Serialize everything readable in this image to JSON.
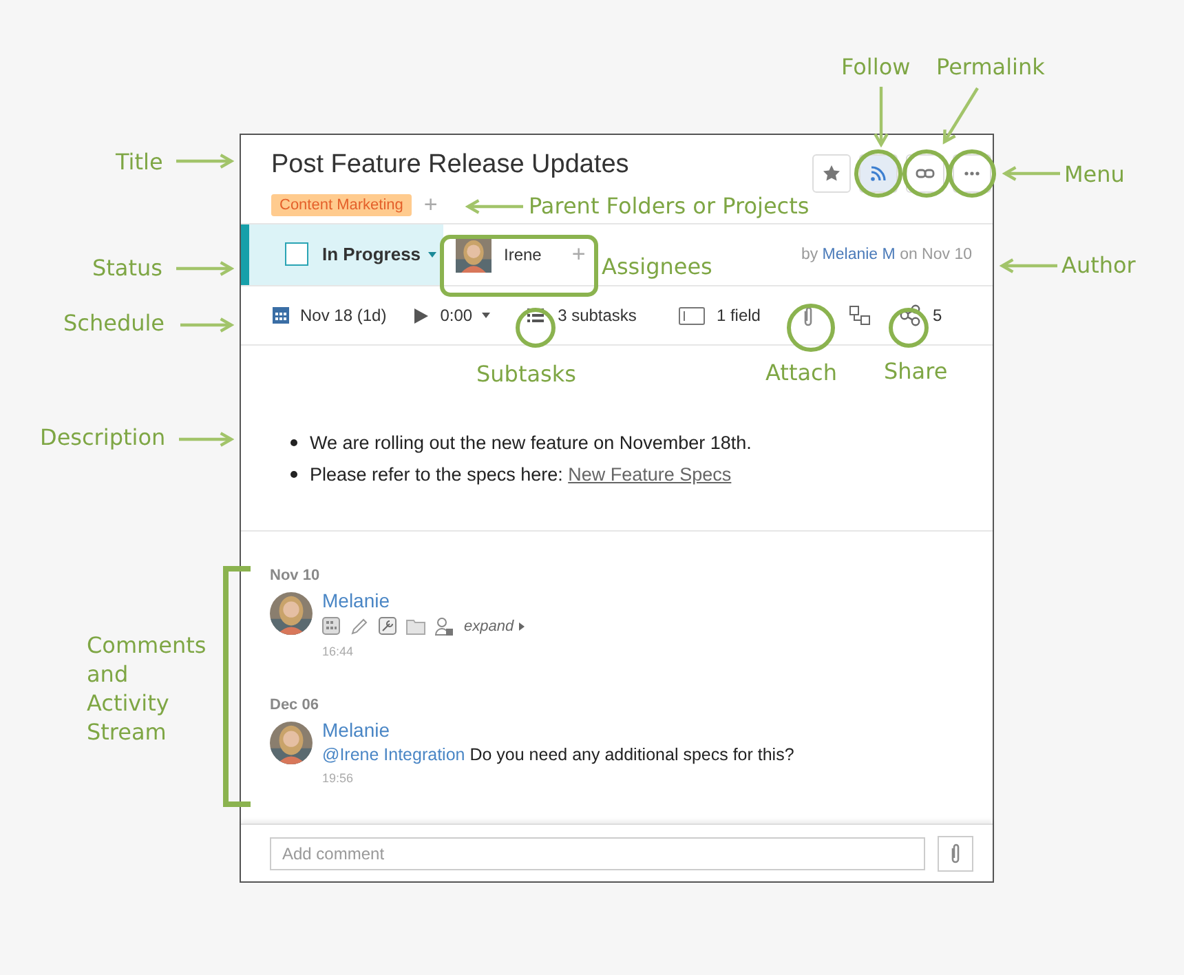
{
  "task": {
    "title": "Post Feature Release Updates",
    "folder_tag": "Content Marketing",
    "add_folder": "+",
    "buttons": [
      {
        "kind": "star",
        "selected": false
      },
      {
        "kind": "follow",
        "selected": true
      },
      {
        "kind": "link",
        "selected": false
      },
      {
        "kind": "menu",
        "selected": false
      }
    ]
  },
  "status": {
    "label": "In Progress",
    "checked": false,
    "assignee": "Irene",
    "add_assignee": "+",
    "author_prefix": "by",
    "author": "Melanie M",
    "author_suffix": "on Nov 10"
  },
  "schedule": {
    "date": "Nov 18 (1d)",
    "timer": "0:00",
    "subtasks": "3 subtasks",
    "fields": "1 field",
    "shares": "5"
  },
  "description": [
    {
      "text": "We are rolling out the new feature on November 18th."
    },
    {
      "text": "Please refer to the specs here: ",
      "link": "New Feature Specs"
    }
  ],
  "stream": [
    {
      "date": "Nov 10",
      "author": "Melanie",
      "kind": "activity",
      "expand": "expand",
      "time": "16:44"
    },
    {
      "date": "Dec 06",
      "author": "Melanie",
      "kind": "comment",
      "mention": "@Irene Integration",
      "text": "Do you need any additional specs for this?",
      "time": "19:56"
    }
  ],
  "comment_box": {
    "placeholder": "Add comment"
  },
  "annotations": [
    {
      "text": "Title"
    },
    {
      "text": "Status"
    },
    {
      "text": "Schedule"
    },
    {
      "text": "Description"
    },
    {
      "text": "Comments and Activity Stream"
    },
    {
      "text": "Follow"
    },
    {
      "text": "Permalink"
    },
    {
      "text": "Menu"
    },
    {
      "text": "Author"
    },
    {
      "text": "Parent Folders or Projects"
    },
    {
      "text": "Assignees"
    },
    {
      "text": "Subtasks"
    },
    {
      "text": "Attach"
    },
    {
      "text": "Share"
    }
  ]
}
